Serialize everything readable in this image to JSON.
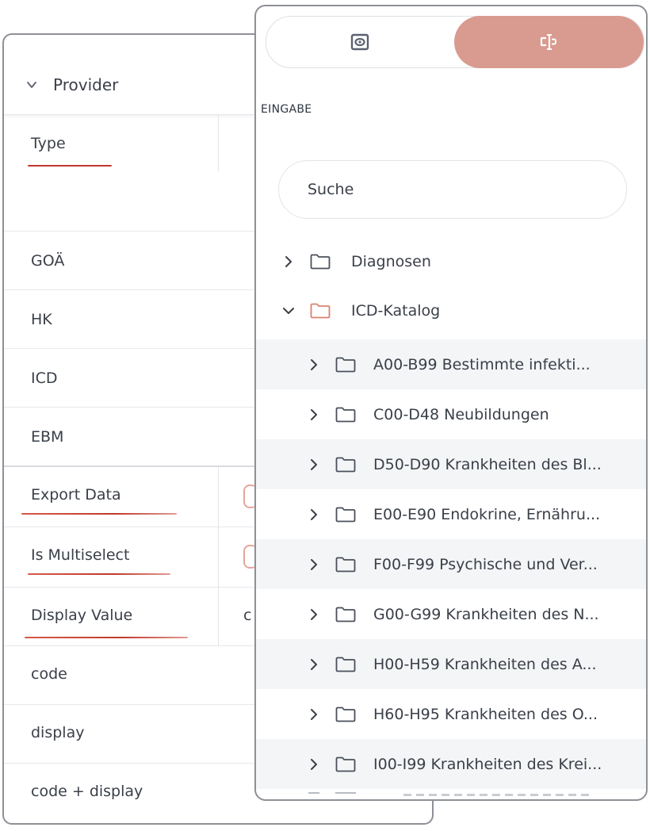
{
  "provider_panel": {
    "title": "Provider",
    "rows": [
      {
        "label": "Type"
      },
      {
        "label": "GOÄ"
      },
      {
        "label": "HK"
      },
      {
        "label": "ICD"
      },
      {
        "label": "EBM"
      },
      {
        "label": "Export Data"
      },
      {
        "label": "Is Multiselect"
      },
      {
        "label": "Display Value"
      },
      {
        "label": "code"
      },
      {
        "label": "display"
      },
      {
        "label": "code + display"
      }
    ],
    "display_value_partial": "c"
  },
  "catalog_panel": {
    "toggle": {
      "left_icon": "preview-icon",
      "right_icon": "text-input-cursor-icon",
      "active": "right",
      "active_color": "#d99a8f"
    },
    "section_label": "EINGABE",
    "search": {
      "placeholder": "Suche",
      "value": ""
    },
    "tree": [
      {
        "label": "Diagnosen",
        "expanded": false,
        "level": 0
      },
      {
        "label": "ICD-Katalog",
        "expanded": true,
        "level": 0,
        "highlight_color": "#d9826f"
      },
      {
        "label": "A00-B99 Bestimmte infekti...",
        "level": 1
      },
      {
        "label": "C00-D48 Neubildungen",
        "level": 1
      },
      {
        "label": "D50-D90 Krankheiten des Bl...",
        "level": 1
      },
      {
        "label": "E00-E90 Endokrine, Ernähru...",
        "level": 1
      },
      {
        "label": "F00-F99 Psychische und Ver...",
        "level": 1
      },
      {
        "label": "G00-G99 Krankheiten des N...",
        "level": 1
      },
      {
        "label": "H00-H59 Krankheiten des A...",
        "level": 1
      },
      {
        "label": "H60-H95 Krankheiten des O...",
        "level": 1
      },
      {
        "label": "I00-I99 Krankheiten des Krei...",
        "level": 1
      }
    ]
  },
  "colors": {
    "accent": "#d99a8f",
    "annotation_red": "#c0392b",
    "border": "#8d9096"
  }
}
